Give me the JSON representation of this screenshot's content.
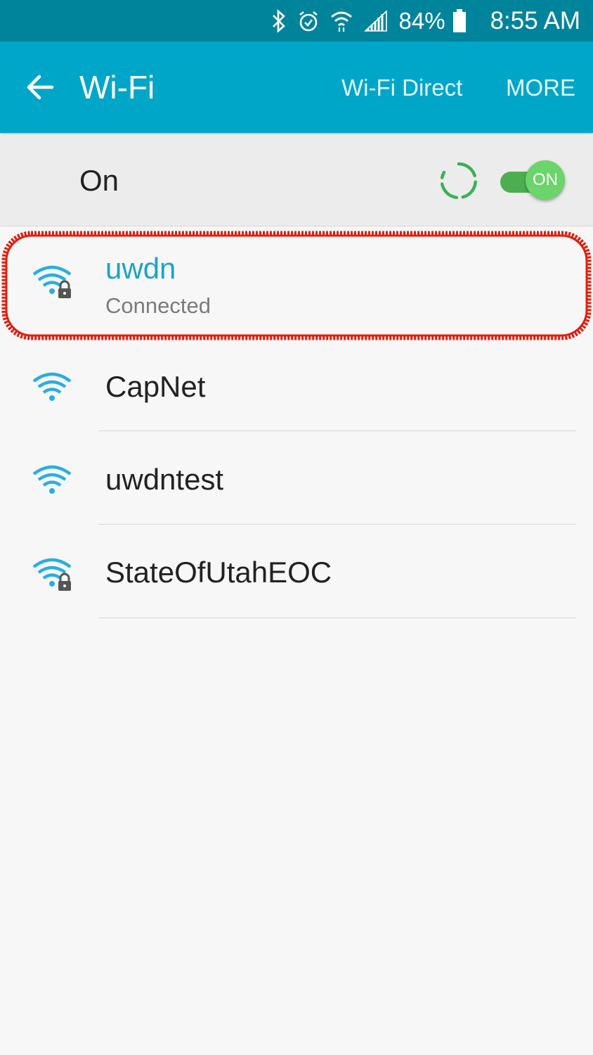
{
  "status_bar": {
    "battery": "84%",
    "time": "8:55 AM",
    "icons": [
      "bluetooth-icon",
      "alarm-icon",
      "wifi-icon",
      "signal-icon",
      "battery-icon"
    ]
  },
  "app_bar": {
    "title": "Wi-Fi",
    "wifi_direct": "Wi-Fi Direct",
    "more": "MORE",
    "back_icon": "back-arrow-icon"
  },
  "master_switch": {
    "label": "On",
    "toggle_text": "ON",
    "is_on": true
  },
  "networks": [
    {
      "name": "uwdn",
      "status": "Connected",
      "secured": true,
      "connected": true
    },
    {
      "name": "CapNet",
      "secured": false,
      "connected": false
    },
    {
      "name": "uwdntest",
      "secured": false,
      "connected": false
    },
    {
      "name": "StateOfUtahEOC",
      "secured": true,
      "connected": false
    }
  ],
  "colors": {
    "status_bar": "#00849c",
    "app_bar": "#00a6c8",
    "accent": "#1ba3c9",
    "toggle": "#4cae50",
    "highlight": "#e02010"
  }
}
